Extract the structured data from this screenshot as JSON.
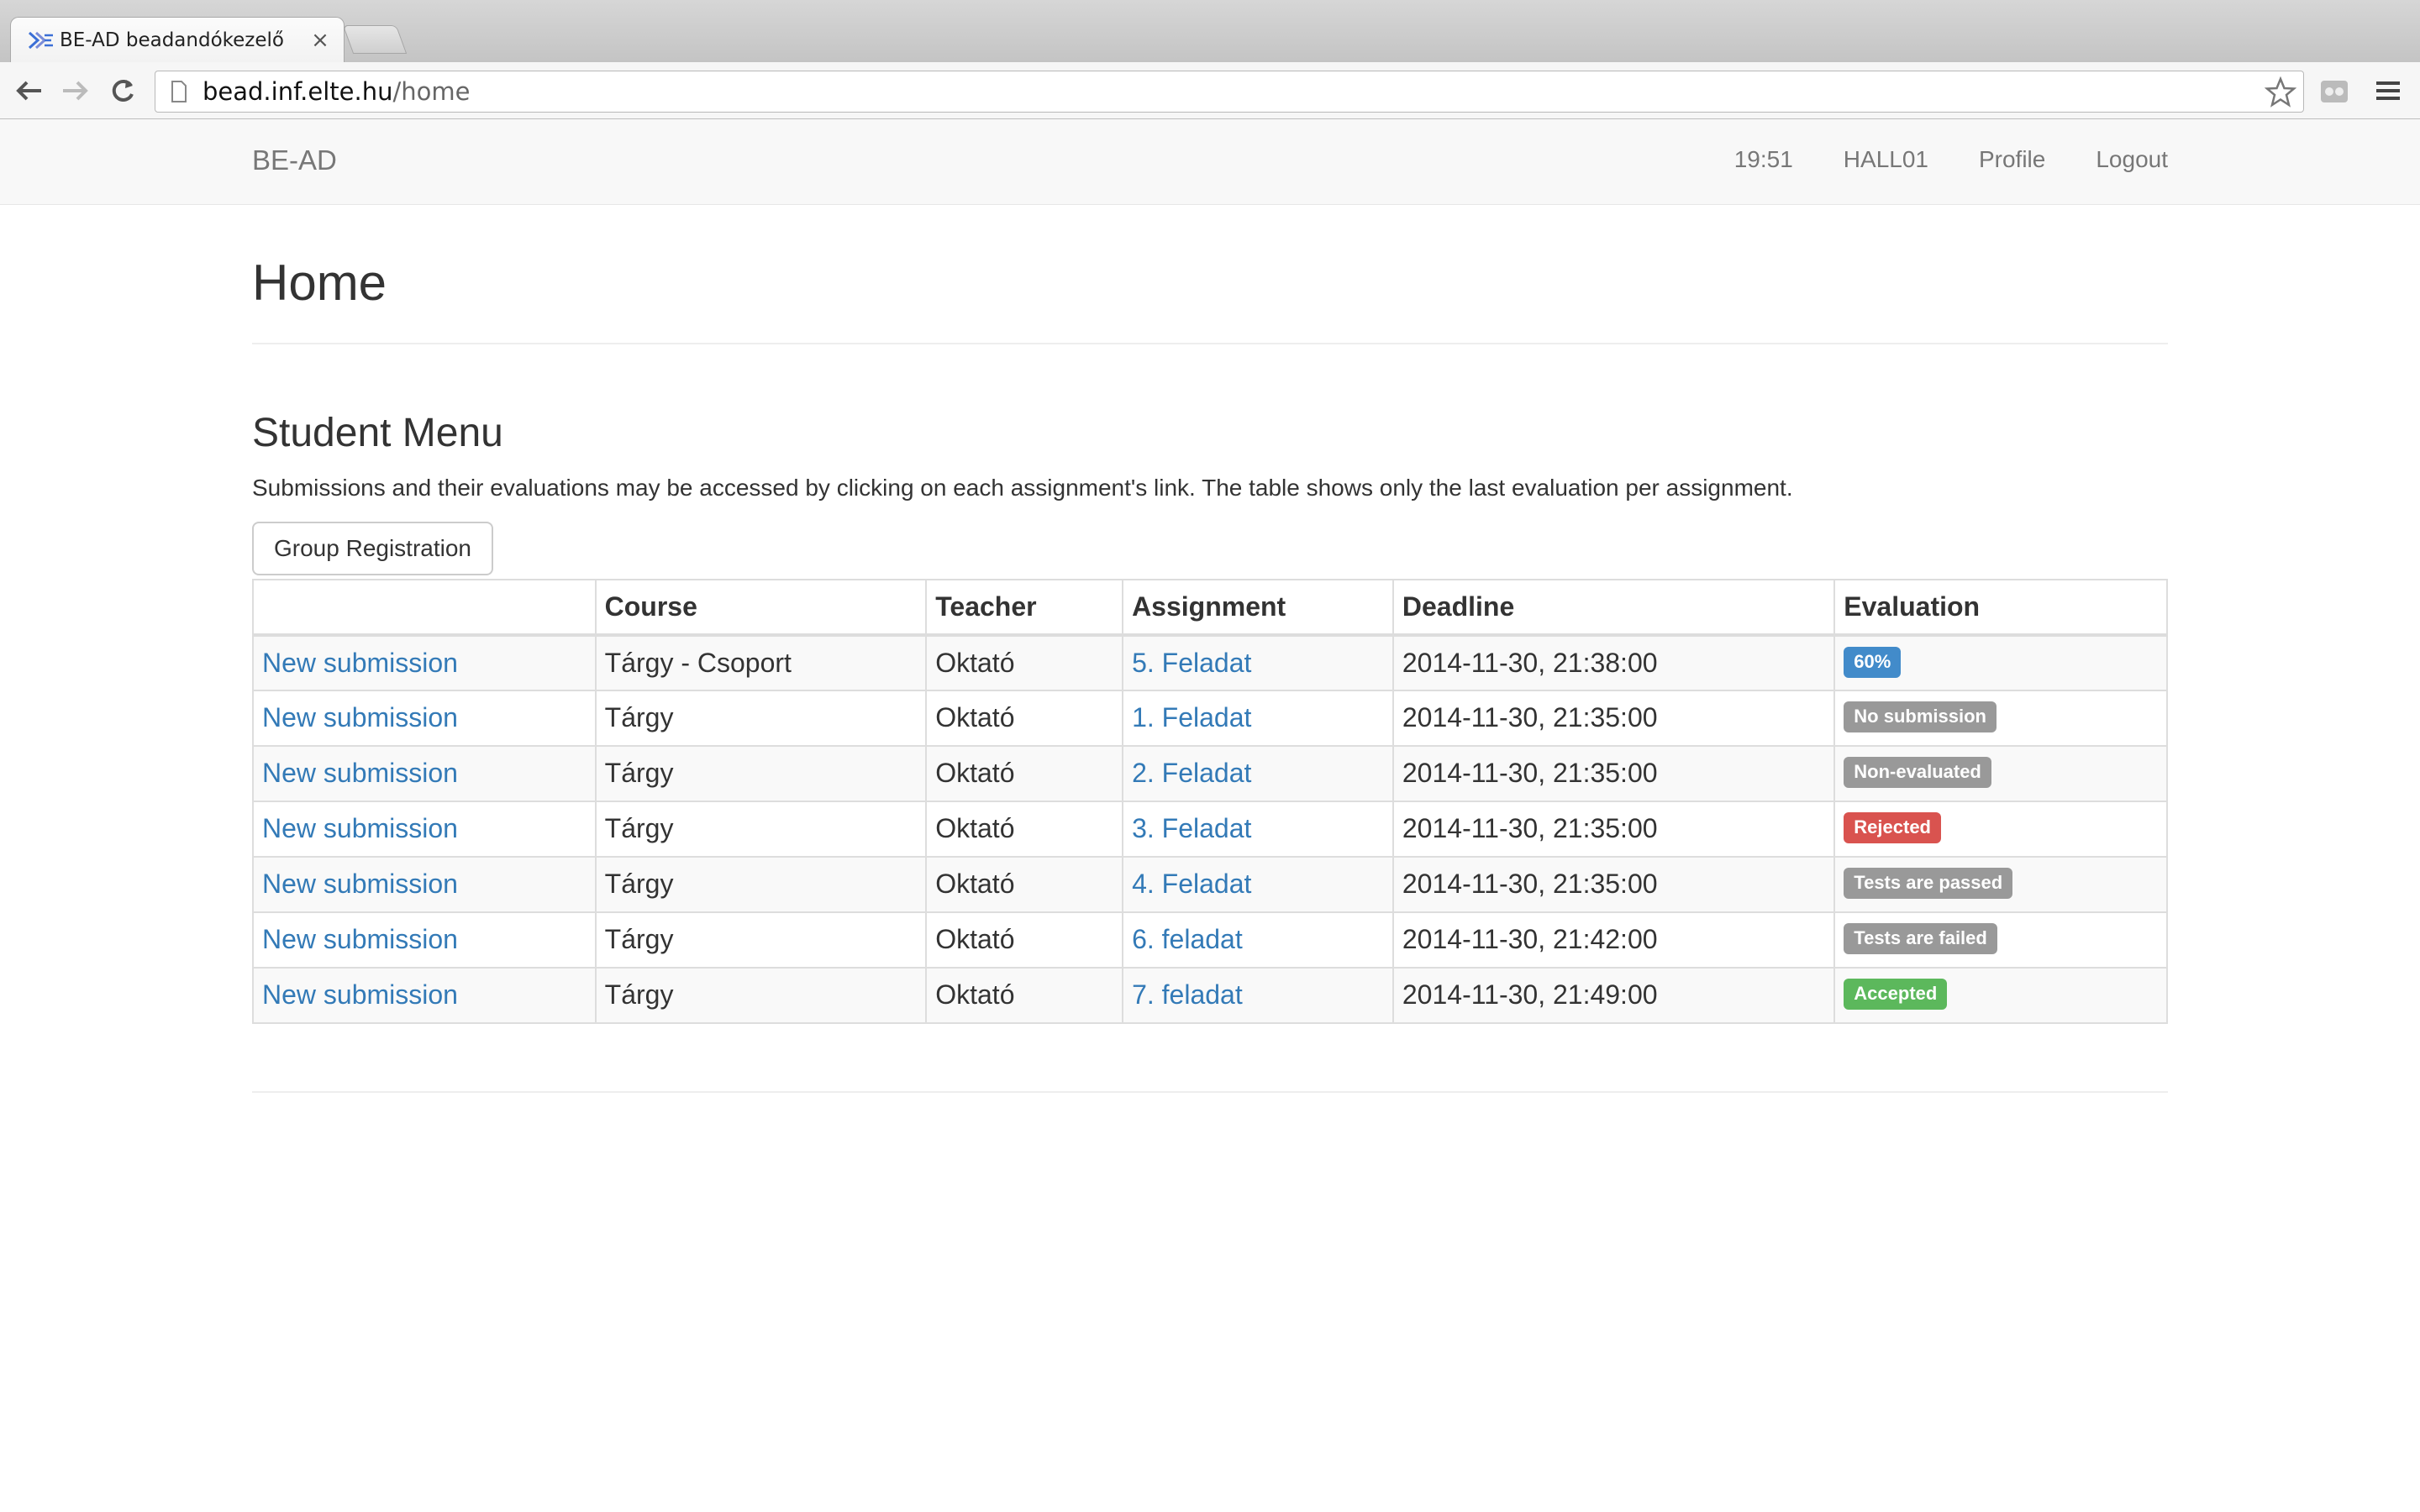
{
  "browser": {
    "tab_title": "BE-AD beadandókezelő",
    "tab_close": "×",
    "url_host": "bead.inf.elte.hu",
    "url_path": "/home"
  },
  "navbar": {
    "brand": "BE-AD",
    "time": "19:51",
    "user": "HALL01",
    "profile": "Profile",
    "logout": "Logout"
  },
  "page": {
    "title": "Home",
    "section_title": "Student Menu",
    "intro": "Submissions and their evaluations may be accessed by clicking on each assignment's link. The table shows only the last evaluation per assignment.",
    "group_registration": "Group Registration"
  },
  "table": {
    "headers": [
      "",
      "Course",
      "Teacher",
      "Assignment",
      "Deadline",
      "Evaluation"
    ],
    "rows": [
      {
        "action": "New submission",
        "course": "Tárgy - Csoport",
        "teacher": "Oktató",
        "assignment": "5. Feladat",
        "deadline": "2014-11-30, 21:38:00",
        "evaluation": "60%",
        "status": "primary"
      },
      {
        "action": "New submission",
        "course": "Tárgy",
        "teacher": "Oktató",
        "assignment": "1. Feladat",
        "deadline": "2014-11-30, 21:35:00",
        "evaluation": "No submission",
        "status": "default"
      },
      {
        "action": "New submission",
        "course": "Tárgy",
        "teacher": "Oktató",
        "assignment": "2. Feladat",
        "deadline": "2014-11-30, 21:35:00",
        "evaluation": "Non-evaluated",
        "status": "default"
      },
      {
        "action": "New submission",
        "course": "Tárgy",
        "teacher": "Oktató",
        "assignment": "3. Feladat",
        "deadline": "2014-11-30, 21:35:00",
        "evaluation": "Rejected",
        "status": "danger"
      },
      {
        "action": "New submission",
        "course": "Tárgy",
        "teacher": "Oktató",
        "assignment": "4. Feladat",
        "deadline": "2014-11-30, 21:35:00",
        "evaluation": "Tests are passed",
        "status": "default"
      },
      {
        "action": "New submission",
        "course": "Tárgy",
        "teacher": "Oktató",
        "assignment": "6. feladat",
        "deadline": "2014-11-30, 21:42:00",
        "evaluation": "Tests are failed",
        "status": "default"
      },
      {
        "action": "New submission",
        "course": "Tárgy",
        "teacher": "Oktató",
        "assignment": "7. feladat",
        "deadline": "2014-11-30, 21:49:00",
        "evaluation": "Accepted",
        "status": "success"
      }
    ]
  },
  "colors": {
    "link": "#337ab7",
    "label_primary": "#428bca",
    "label_default": "#999999",
    "label_danger": "#d9534f",
    "label_success": "#5cb85c"
  },
  "icons": [
    "back-arrow-icon",
    "forward-arrow-icon",
    "reload-icon",
    "page-icon",
    "star-icon",
    "extension-icon",
    "menu-icon",
    "favicon-icon"
  ]
}
